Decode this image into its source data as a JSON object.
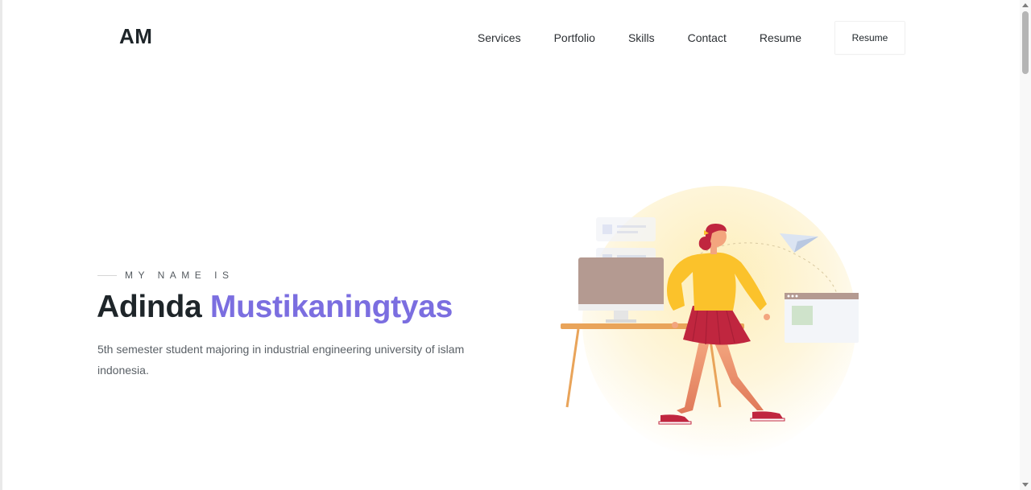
{
  "header": {
    "logo": "AM",
    "nav": [
      "Services",
      "Portfolio",
      "Skills",
      "Contact",
      "Resume"
    ],
    "cta_label": "Resume"
  },
  "hero": {
    "eyebrow": "MY NAME IS",
    "first_name": "Adinda",
    "last_name": "Mustikaningtyas",
    "description": "5th semester student majoring in industrial engineering university of islam indonesia."
  },
  "colors": {
    "accent": "#7b6ee0",
    "heading": "#1e2529",
    "body_text": "#5a6066",
    "illustration_circle": "#fdf1c9",
    "sweater": "#fbc22b",
    "skirt": "#c0263f"
  },
  "icons": {
    "illustration": "woman-walking-at-desk-illustration",
    "paper_plane": "paper-plane-icon",
    "monitor": "monitor-icon",
    "chat_bubble": "chat-bubble-icon"
  }
}
